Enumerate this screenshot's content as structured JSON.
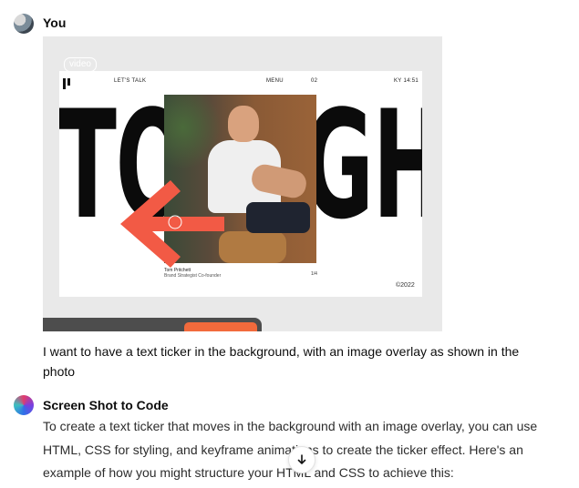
{
  "user": {
    "name": "You"
  },
  "assistant": {
    "name": "Screen Shot to Code"
  },
  "attachment": {
    "video_label": "video",
    "nav": {
      "lets_talk": "LET'S TALK",
      "menu": "MENU",
      "num": "02",
      "location": "KY 14:51"
    },
    "ticker_text": "TOM GHAR",
    "caption_name": "Tom Pritchett",
    "caption_sub": "Brand Strategist Co-founder",
    "caption_num": "1/4",
    "copyright": "©2022",
    "colors": {
      "arrow": "#f25a45",
      "accent_button": "#f26a3c"
    }
  },
  "messages": {
    "user_text": "I want to have a text ticker in the background, with an image overlay as shown in the photo",
    "assistant_text": "To create a text ticker that moves in the background with an image overlay, you can use HTML, CSS for styling, and keyframe animations to create the ticker effect. Here's an example of how you might structure your HTML and CSS to achieve this:"
  },
  "icons": {
    "scroll_down": "arrow-down-icon"
  }
}
